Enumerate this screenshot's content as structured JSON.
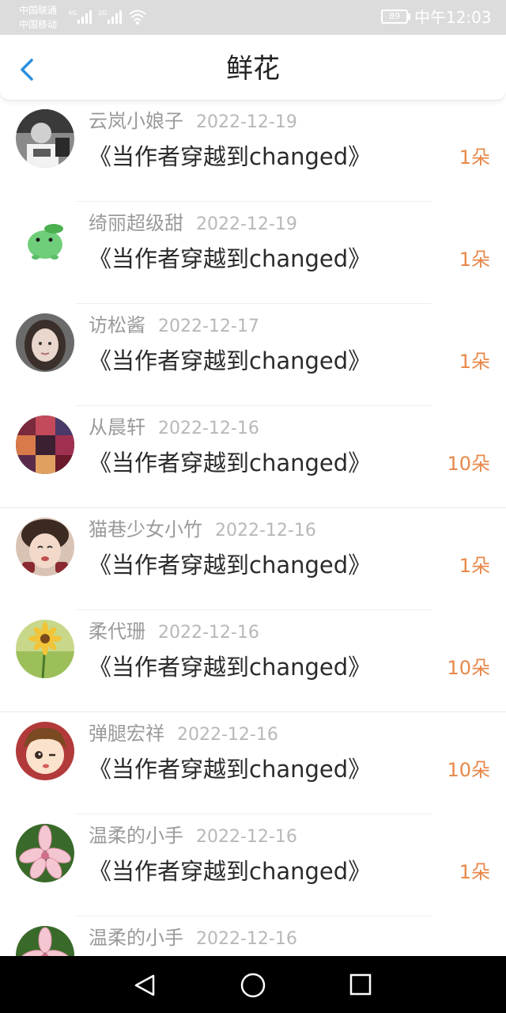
{
  "status_bar": {
    "carrier_1": "中国联通",
    "carrier_2": "中国移动",
    "network_1": "4G",
    "network_2": "2G",
    "battery": "89",
    "time": "中午12:03"
  },
  "header": {
    "title": "鲜花"
  },
  "colors": {
    "accent": "#e8884a",
    "back_arrow": "#2a8fe0",
    "name_text": "#9a9a9a",
    "date_text": "#b8b8b8"
  },
  "list": [
    {
      "name": "云岚小娘子",
      "date": "2022-12-19",
      "book": "《当作者穿越到changed》",
      "count": "1朵",
      "avatar": "bw-photo-avatar"
    },
    {
      "name": "绮丽超级甜",
      "date": "2022-12-19",
      "book": "《当作者穿越到changed》",
      "count": "1朵",
      "avatar": "green-frog-avatar"
    },
    {
      "name": "访松酱",
      "date": "2022-12-17",
      "book": "《当作者穿越到changed》",
      "count": "1朵",
      "avatar": "girl-photo-avatar"
    },
    {
      "name": "从晨轩",
      "date": "2022-12-16",
      "book": "《当作者穿越到changed》",
      "count": "10朵",
      "avatar": "collage-avatar"
    },
    {
      "name": "猫巷少女小竹",
      "date": "2022-12-16",
      "book": "《当作者穿越到changed》",
      "count": "1朵",
      "avatar": "crying-girl-avatar"
    },
    {
      "name": "柔代珊",
      "date": "2022-12-16",
      "book": "《当作者穿越到changed》",
      "count": "10朵",
      "avatar": "daisy-avatar"
    },
    {
      "name": "弹腿宏祥",
      "date": "2022-12-16",
      "book": "《当作者穿越到changed》",
      "count": "10朵",
      "avatar": "cartoon-boy-avatar"
    },
    {
      "name": "温柔的小手",
      "date": "2022-12-16",
      "book": "《当作者穿越到changed》",
      "count": "1朵",
      "avatar": "pink-lily-avatar"
    },
    {
      "name": "温柔的小手",
      "date": "2022-12-16",
      "book": "",
      "count": "",
      "avatar": "pink-lily-avatar"
    }
  ],
  "nav_bar": {
    "icons": [
      "nav-back-icon",
      "nav-home-icon",
      "nav-recent-icon"
    ]
  }
}
